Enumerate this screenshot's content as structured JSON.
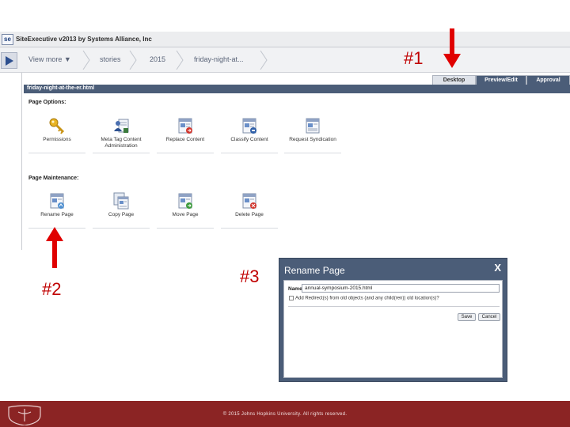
{
  "app": {
    "logo": "se",
    "title": "SiteExecutive v2013 by Systems Alliance, Inc"
  },
  "nav": {
    "view_more": "View more ▼",
    "breadcrumbs": [
      "stories",
      "2015",
      "friday-night-at..."
    ]
  },
  "tabs": [
    "Desktop",
    "Preview/Edit",
    "Approval"
  ],
  "page": {
    "filename": "friday-night-at-the-er.html"
  },
  "page_options": {
    "heading": "Page Options:",
    "tools": [
      {
        "label": "Permissions",
        "icon": "key-icon"
      },
      {
        "label": "Meta Tag Content Administration",
        "icon": "user-document-icon"
      },
      {
        "label": "Replace Content",
        "icon": "replace-content-icon"
      },
      {
        "label": "Classify Content",
        "icon": "classify-content-icon"
      },
      {
        "label": "Request Syndication",
        "icon": "syndication-icon"
      }
    ]
  },
  "page_maintenance": {
    "heading": "Page Maintenance:",
    "tools": [
      {
        "label": "Rename Page",
        "icon": "rename-page-icon"
      },
      {
        "label": "Copy Page",
        "icon": "copy-page-icon"
      },
      {
        "label": "Move Page",
        "icon": "move-page-icon"
      },
      {
        "label": "Delete Page",
        "icon": "delete-page-icon"
      }
    ]
  },
  "annotations": {
    "one": "#1",
    "two": "#2",
    "three": "#3"
  },
  "dialog": {
    "title": "Rename Page",
    "close": "X",
    "name_label": "Name:",
    "name_value": "annual-symposium-2015.html",
    "redirect_text": "Add Redirect(s) from old objects (and any child(ren)) old location(s)?",
    "save": "Save",
    "cancel": "Cancel"
  },
  "footer": {
    "copyright": "© 2015 Johns Hopkins University. All rights reserved."
  },
  "colors": {
    "accent_dark": "#4b5d78",
    "annotation_red": "#c00000",
    "footer_red": "#8b2424"
  }
}
